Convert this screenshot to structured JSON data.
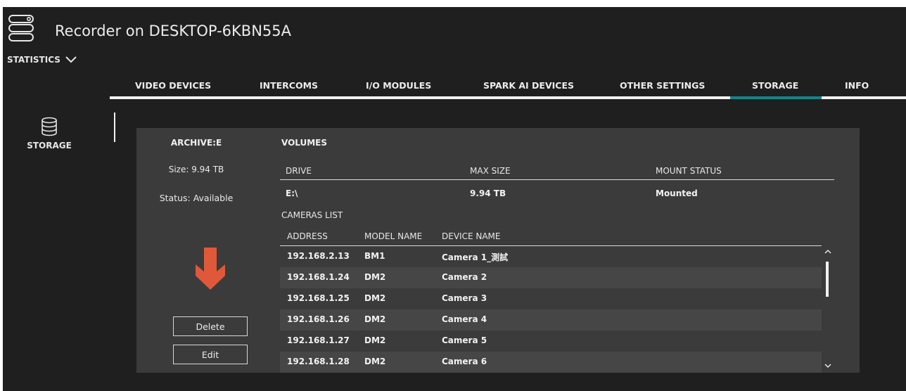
{
  "app": {
    "title": "Recorder on DESKTOP-6KBN55A",
    "icon": "server-stack-icon",
    "statistics_label": "STATISTICS"
  },
  "tabs": [
    {
      "label": "VIDEO DEVICES",
      "active": false
    },
    {
      "label": "INTERCOMS",
      "active": false
    },
    {
      "label": "I/O MODULES",
      "active": false
    },
    {
      "label": "SPARK AI DEVICES",
      "active": false
    },
    {
      "label": "OTHER SETTINGS",
      "active": false
    },
    {
      "label": "STORAGE",
      "active": true
    },
    {
      "label": "INFO",
      "active": false
    }
  ],
  "sidebar": {
    "storage_label": "STORAGE",
    "storage_icon": "database-icon"
  },
  "archive": {
    "title": "ARCHIVE:E",
    "size": "Size: 9.94 TB",
    "status": "Status: Available",
    "delete_label": "Delete",
    "edit_label": "Edit"
  },
  "volumes": {
    "title": "VOLUMES",
    "headers": {
      "drive": "DRIVE",
      "max_size": "MAX SIZE",
      "mount_status": "MOUNT STATUS"
    },
    "rows": [
      {
        "drive": "E:\\",
        "max_size": "9.94 TB",
        "mount_status": "Mounted"
      }
    ]
  },
  "cameras": {
    "title": "CAMERAS LIST",
    "headers": {
      "address": "ADDRESS",
      "model": "MODEL NAME",
      "device": "DEVICE NAME"
    },
    "rows": [
      {
        "address": "192.168.2.13",
        "model": "BM1",
        "device": "Camera 1_測試"
      },
      {
        "address": "192.168.1.24",
        "model": "DM2",
        "device": "Camera 2"
      },
      {
        "address": "192.168.1.25",
        "model": "DM2",
        "device": "Camera 3"
      },
      {
        "address": "192.168.1.26",
        "model": "DM2",
        "device": "Camera 4"
      },
      {
        "address": "192.168.1.27",
        "model": "DM2",
        "device": "Camera 5"
      },
      {
        "address": "192.168.1.28",
        "model": "DM2",
        "device": "Camera 6"
      }
    ]
  },
  "colors": {
    "background": "#1f1f1f",
    "panel": "#3b3b3b",
    "accent": "#17838a",
    "arrow": "#e0583a"
  }
}
